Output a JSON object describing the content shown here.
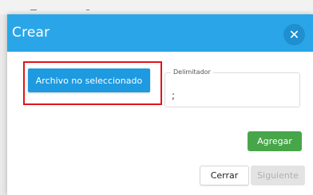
{
  "dialog": {
    "title": "Crear",
    "close_icon": "close-icon",
    "header_color": "#2aa6e8"
  },
  "file_button": {
    "label": "Archivo no seleccionado",
    "highlight_color": "#e3141b"
  },
  "delimiter": {
    "label": "Delimitador",
    "value": ";"
  },
  "buttons": {
    "agregar": "Agregar",
    "cerrar": "Cerrar",
    "siguiente": "Siguiente",
    "siguiente_disabled": true,
    "agregar_color": "#47a64a"
  }
}
